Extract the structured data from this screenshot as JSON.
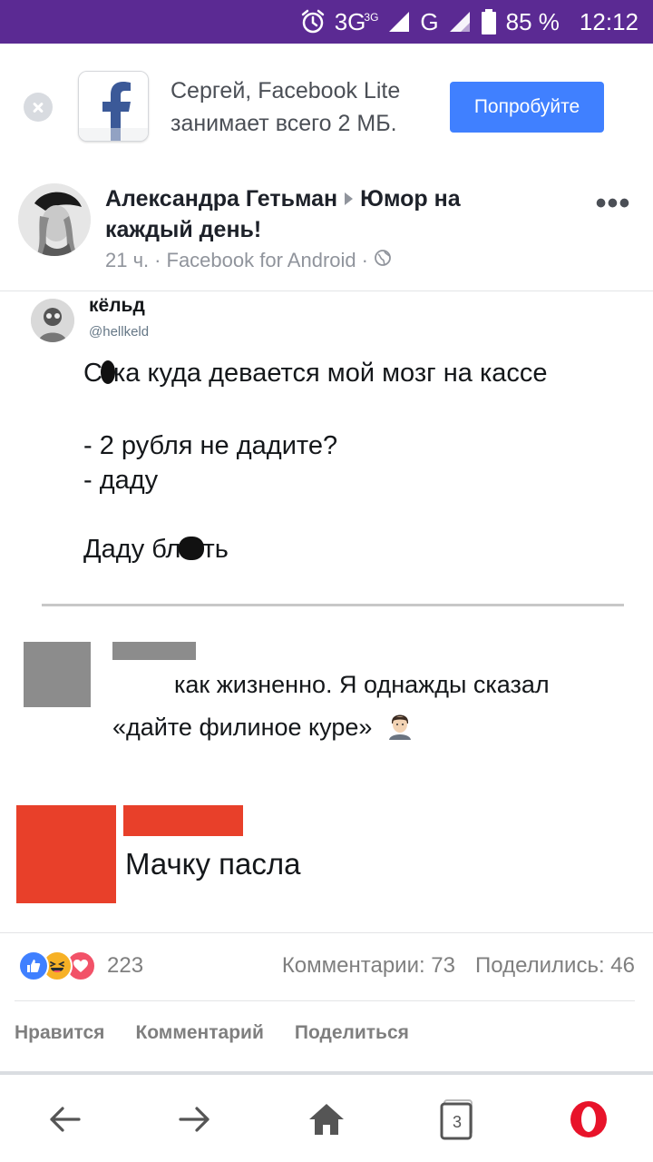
{
  "status_bar": {
    "network_primary": "3G",
    "network_secondary": "3G",
    "network_tertiary": "G",
    "battery": "85 %",
    "time": "12:12"
  },
  "promo": {
    "text": "Сергей, Facebook Lite занимает всего 2 МБ.",
    "button_label": "Попробуйте",
    "accent_color": "#4080ff"
  },
  "post": {
    "author": "Александра Гетьман",
    "group": "Юмор на каждый день!",
    "time": "21 ч.",
    "source": "Facebook for Android",
    "separator": "·",
    "privacy_icon": "globe-icon",
    "more_icon": "more-dots-icon"
  },
  "image": {
    "tweet_name": "кёльд",
    "tweet_handle": "@hellkeld",
    "line1_pre": "С",
    "line1_post": "ка куда девается мой  мозг на кассе",
    "line2": "- 2 рубля не дадите?",
    "line3": "- даду",
    "line4_pre": "Даду бл",
    "line4_post": "ть",
    "comment1_a": "как жизненно. Я однажды сказал",
    "comment1_b": "«дайте филиное куре»",
    "comment2": "Мачку пасла"
  },
  "engagement": {
    "reactions_count": "223",
    "comments": "Комментарии: 73",
    "shares": "Поделились: 46",
    "like_label": "Нравится",
    "comment_label": "Комментарий",
    "share_label": "Поделиться"
  },
  "browser_nav": {
    "tabs_count": "3",
    "icons": [
      "back-arrow-icon",
      "forward-arrow-icon",
      "home-icon",
      "tabs-icon",
      "opera-icon"
    ]
  }
}
